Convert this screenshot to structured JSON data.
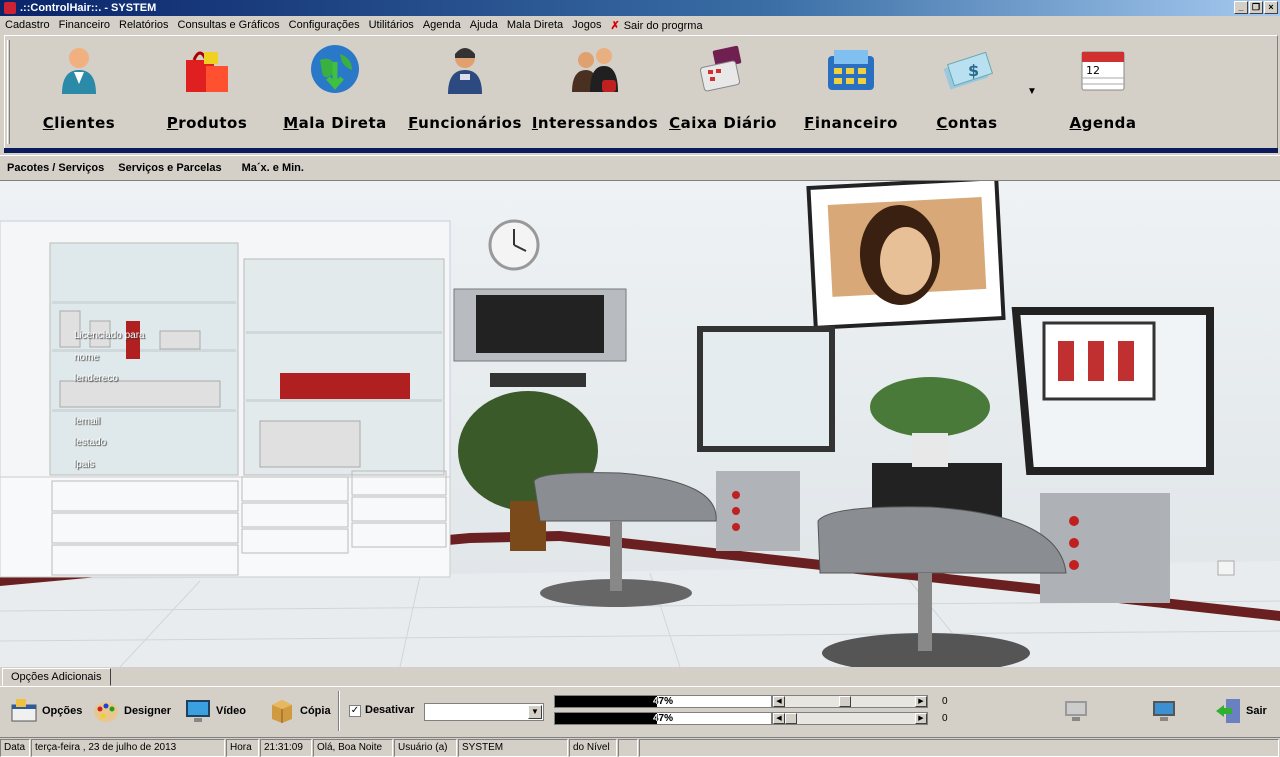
{
  "window": {
    "title": ".::ControlHair::. - SYSTEM"
  },
  "menu": [
    "Cadastro",
    "Financeiro",
    "Relatórios",
    "Consultas e Gráficos",
    "Configurações",
    "Utilitários",
    "Agenda",
    "Ajuda",
    "Mala Direta",
    "Jogos"
  ],
  "menu_exit": "Sair do progrma",
  "toolbar": {
    "items": [
      {
        "label": "Clientes",
        "icon": "client-icon"
      },
      {
        "label": "Produtos",
        "icon": "shopping-bags-icon"
      },
      {
        "label": "Mala Direta",
        "icon": "globe-icon"
      },
      {
        "label": "Funcionários",
        "icon": "employee-icon"
      },
      {
        "label": "Interessandos",
        "icon": "people-group-icon"
      },
      {
        "label": "Caixa Diário",
        "icon": "cash-register-icon"
      },
      {
        "label": "Financeiro",
        "icon": "calculator-icon"
      },
      {
        "label": "Contas",
        "icon": "money-icon"
      },
      {
        "label": "Agenda",
        "icon": "calendar-icon"
      }
    ],
    "dropdown": "▼"
  },
  "subbar": [
    "Pacotes / Serviços",
    "Serviços e Parcelas",
    "Ma´x. e Min."
  ],
  "info_lines": [
    "Licenciado para",
    "nome",
    "lendereco",
    "lemail",
    "lestado",
    "lpais"
  ],
  "tab": "Opções Adicionais",
  "options": {
    "opcoes": "Opções",
    "designer": "Designer",
    "video": "Vídeo",
    "copia": "Cópia",
    "desativar": "Desativar",
    "desativar_checked": true,
    "combo_value": "",
    "progress1": {
      "label": "47%",
      "value": 0.47
    },
    "progress2": {
      "label": "47%",
      "value": 0.47
    },
    "scroll1": {
      "value": 0.46,
      "readout": "0"
    },
    "scroll2": {
      "value": 0.0,
      "readout": "0"
    },
    "sair": "Sair"
  },
  "status": {
    "data_label": "Data",
    "date": "terça-feira , 23 de  julho  de  2013",
    "hora_label": "Hora",
    "time": "21:31:09",
    "greeting": "Olá, Boa Noite",
    "user_label": "Usuário (a)",
    "user": "SYSTEM",
    "level": "do Nível",
    "extra": ""
  },
  "colors": {
    "title_bar": "#0a246a",
    "face": "#d4d0c8",
    "accent_navy": "#0a1a5a"
  }
}
